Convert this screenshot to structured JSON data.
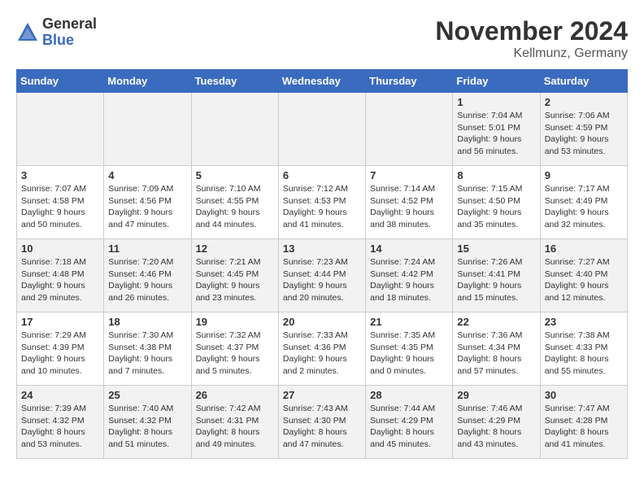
{
  "logo": {
    "text_general": "General",
    "text_blue": "Blue"
  },
  "title": "November 2024",
  "subtitle": "Kellmunz, Germany",
  "days_of_week": [
    "Sunday",
    "Monday",
    "Tuesday",
    "Wednesday",
    "Thursday",
    "Friday",
    "Saturday"
  ],
  "weeks": [
    [
      {
        "day": "",
        "info": ""
      },
      {
        "day": "",
        "info": ""
      },
      {
        "day": "",
        "info": ""
      },
      {
        "day": "",
        "info": ""
      },
      {
        "day": "",
        "info": ""
      },
      {
        "day": "1",
        "info": "Sunrise: 7:04 AM\nSunset: 5:01 PM\nDaylight: 9 hours and 56 minutes."
      },
      {
        "day": "2",
        "info": "Sunrise: 7:06 AM\nSunset: 4:59 PM\nDaylight: 9 hours and 53 minutes."
      }
    ],
    [
      {
        "day": "3",
        "info": "Sunrise: 7:07 AM\nSunset: 4:58 PM\nDaylight: 9 hours and 50 minutes."
      },
      {
        "day": "4",
        "info": "Sunrise: 7:09 AM\nSunset: 4:56 PM\nDaylight: 9 hours and 47 minutes."
      },
      {
        "day": "5",
        "info": "Sunrise: 7:10 AM\nSunset: 4:55 PM\nDaylight: 9 hours and 44 minutes."
      },
      {
        "day": "6",
        "info": "Sunrise: 7:12 AM\nSunset: 4:53 PM\nDaylight: 9 hours and 41 minutes."
      },
      {
        "day": "7",
        "info": "Sunrise: 7:14 AM\nSunset: 4:52 PM\nDaylight: 9 hours and 38 minutes."
      },
      {
        "day": "8",
        "info": "Sunrise: 7:15 AM\nSunset: 4:50 PM\nDaylight: 9 hours and 35 minutes."
      },
      {
        "day": "9",
        "info": "Sunrise: 7:17 AM\nSunset: 4:49 PM\nDaylight: 9 hours and 32 minutes."
      }
    ],
    [
      {
        "day": "10",
        "info": "Sunrise: 7:18 AM\nSunset: 4:48 PM\nDaylight: 9 hours and 29 minutes."
      },
      {
        "day": "11",
        "info": "Sunrise: 7:20 AM\nSunset: 4:46 PM\nDaylight: 9 hours and 26 minutes."
      },
      {
        "day": "12",
        "info": "Sunrise: 7:21 AM\nSunset: 4:45 PM\nDaylight: 9 hours and 23 minutes."
      },
      {
        "day": "13",
        "info": "Sunrise: 7:23 AM\nSunset: 4:44 PM\nDaylight: 9 hours and 20 minutes."
      },
      {
        "day": "14",
        "info": "Sunrise: 7:24 AM\nSunset: 4:42 PM\nDaylight: 9 hours and 18 minutes."
      },
      {
        "day": "15",
        "info": "Sunrise: 7:26 AM\nSunset: 4:41 PM\nDaylight: 9 hours and 15 minutes."
      },
      {
        "day": "16",
        "info": "Sunrise: 7:27 AM\nSunset: 4:40 PM\nDaylight: 9 hours and 12 minutes."
      }
    ],
    [
      {
        "day": "17",
        "info": "Sunrise: 7:29 AM\nSunset: 4:39 PM\nDaylight: 9 hours and 10 minutes."
      },
      {
        "day": "18",
        "info": "Sunrise: 7:30 AM\nSunset: 4:38 PM\nDaylight: 9 hours and 7 minutes."
      },
      {
        "day": "19",
        "info": "Sunrise: 7:32 AM\nSunset: 4:37 PM\nDaylight: 9 hours and 5 minutes."
      },
      {
        "day": "20",
        "info": "Sunrise: 7:33 AM\nSunset: 4:36 PM\nDaylight: 9 hours and 2 minutes."
      },
      {
        "day": "21",
        "info": "Sunrise: 7:35 AM\nSunset: 4:35 PM\nDaylight: 9 hours and 0 minutes."
      },
      {
        "day": "22",
        "info": "Sunrise: 7:36 AM\nSunset: 4:34 PM\nDaylight: 8 hours and 57 minutes."
      },
      {
        "day": "23",
        "info": "Sunrise: 7:38 AM\nSunset: 4:33 PM\nDaylight: 8 hours and 55 minutes."
      }
    ],
    [
      {
        "day": "24",
        "info": "Sunrise: 7:39 AM\nSunset: 4:32 PM\nDaylight: 8 hours and 53 minutes."
      },
      {
        "day": "25",
        "info": "Sunrise: 7:40 AM\nSunset: 4:32 PM\nDaylight: 8 hours and 51 minutes."
      },
      {
        "day": "26",
        "info": "Sunrise: 7:42 AM\nSunset: 4:31 PM\nDaylight: 8 hours and 49 minutes."
      },
      {
        "day": "27",
        "info": "Sunrise: 7:43 AM\nSunset: 4:30 PM\nDaylight: 8 hours and 47 minutes."
      },
      {
        "day": "28",
        "info": "Sunrise: 7:44 AM\nSunset: 4:29 PM\nDaylight: 8 hours and 45 minutes."
      },
      {
        "day": "29",
        "info": "Sunrise: 7:46 AM\nSunset: 4:29 PM\nDaylight: 8 hours and 43 minutes."
      },
      {
        "day": "30",
        "info": "Sunrise: 7:47 AM\nSunset: 4:28 PM\nDaylight: 8 hours and 41 minutes."
      }
    ]
  ]
}
